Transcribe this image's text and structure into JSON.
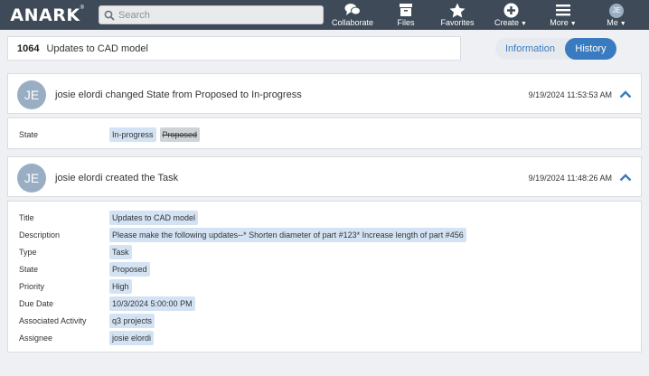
{
  "brand": {
    "name": "ANARK",
    "tm": "®"
  },
  "search": {
    "placeholder": "Search"
  },
  "nav": {
    "collaborate": "Collaborate",
    "files": "Files",
    "favorites": "Favorites",
    "create": "Create",
    "more": "More",
    "me": "Me",
    "me_initials": "JE"
  },
  "task": {
    "id": "1064",
    "title": "Updates to CAD model"
  },
  "tabs": {
    "information": "Information",
    "history": "History"
  },
  "events": [
    {
      "initials": "JE",
      "text": "josie elordi changed State from Proposed to In-progress",
      "time": "9/19/2024 11:53:53 AM",
      "details": {
        "state_label": "State",
        "new_value": "In-progress",
        "old_value": "Proposed"
      }
    },
    {
      "initials": "JE",
      "text": "josie elordi created the Task",
      "time": "9/19/2024 11:48:26 AM",
      "fields": [
        {
          "label": "Title",
          "value": "Updates to CAD model"
        },
        {
          "label": "Description",
          "value": "Please make the following updates--* Shorten diameter of part #123* Increase length of part #456"
        },
        {
          "label": "Type",
          "value": "Task"
        },
        {
          "label": "State",
          "value": "Proposed"
        },
        {
          "label": "Priority",
          "value": "High"
        },
        {
          "label": "Due Date",
          "value": "10/3/2024 5:00:00 PM"
        },
        {
          "label": "Associated Activity",
          "value": "q3 projects"
        },
        {
          "label": "Assignee",
          "value": "josie elordi"
        }
      ]
    }
  ],
  "colors": {
    "topbar": "#3e4a57",
    "accent": "#3a7bbf",
    "chip": "#d3e3f4",
    "avatar": "#9aaec3"
  }
}
